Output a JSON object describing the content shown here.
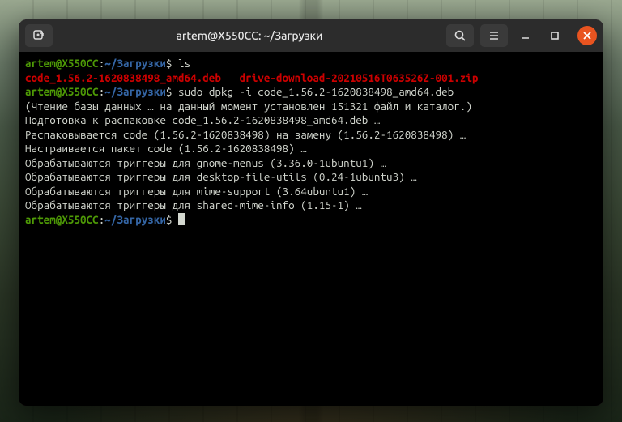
{
  "titlebar": {
    "title": "artem@X550CC: ~/Загрузки"
  },
  "prompt": {
    "user_host": "artem@X550CC",
    "sep": ":",
    "path": "~/Загрузки",
    "dollar": "$"
  },
  "lines": {
    "cmd1": "ls",
    "file1": "code_1.56.2-1620838498_amd64.deb",
    "file2": "drive-download-20210516T063526Z-001.zip",
    "cmd2": "sudo dpkg -i code_1.56.2-1620838498_amd64.deb",
    "out1": "(Чтение базы данных … на данный момент установлен 151321 файл и каталог.)",
    "out2": "Подготовка к распаковке code_1.56.2-1620838498_amd64.deb …",
    "out3": "Распаковывается code (1.56.2-1620838498) на замену (1.56.2-1620838498) …",
    "out4": "Настраивается пакет code (1.56.2-1620838498) …",
    "out5": "Обрабатываются триггеры для gnome-menus (3.36.0-1ubuntu1) …",
    "out6": "Обрабатываются триггеры для desktop-file-utils (0.24-1ubuntu3) …",
    "out7": "Обрабатываются триггеры для mime-support (3.64ubuntu1) …",
    "out8": "Обрабатываются триггеры для shared-mime-info (1.15-1) …"
  }
}
